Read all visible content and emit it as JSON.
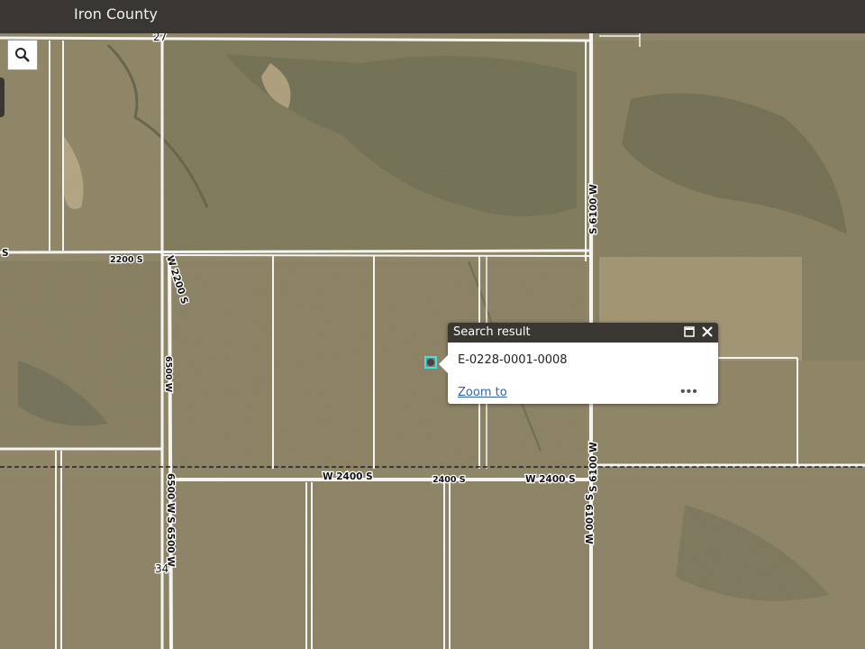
{
  "app": {
    "title": "Iron County"
  },
  "toolbar": {
    "search_icon": "search-icon"
  },
  "map": {
    "road_labels": {
      "w2200s_a": "2200 S",
      "w2200s_b": "W 2200 S",
      "r6500w": "6500 W",
      "w2400s_a": "W 2400 S",
      "w2400s_b": "2400 S",
      "w2400s_c": "W 2400 S",
      "s6500w": "6500 W S 6500 W",
      "s6100w_top": "S 6100 W",
      "s6100w_mid": "S 6100 W",
      "s6100w_bottom": "S 6100 W",
      "left_s": "S"
    },
    "section_numbers": {
      "top": "27",
      "bottom": "34"
    }
  },
  "popup": {
    "title": "Search result",
    "result_id": "E-0228-0001-0008",
    "zoom_label": "Zoom to",
    "more_label": "•••",
    "maximize_icon": "maximize-icon",
    "close_icon": "close-icon"
  },
  "colors": {
    "header": "#3a3631",
    "link": "#2f64a8",
    "highlight": "#3fe0ef"
  }
}
